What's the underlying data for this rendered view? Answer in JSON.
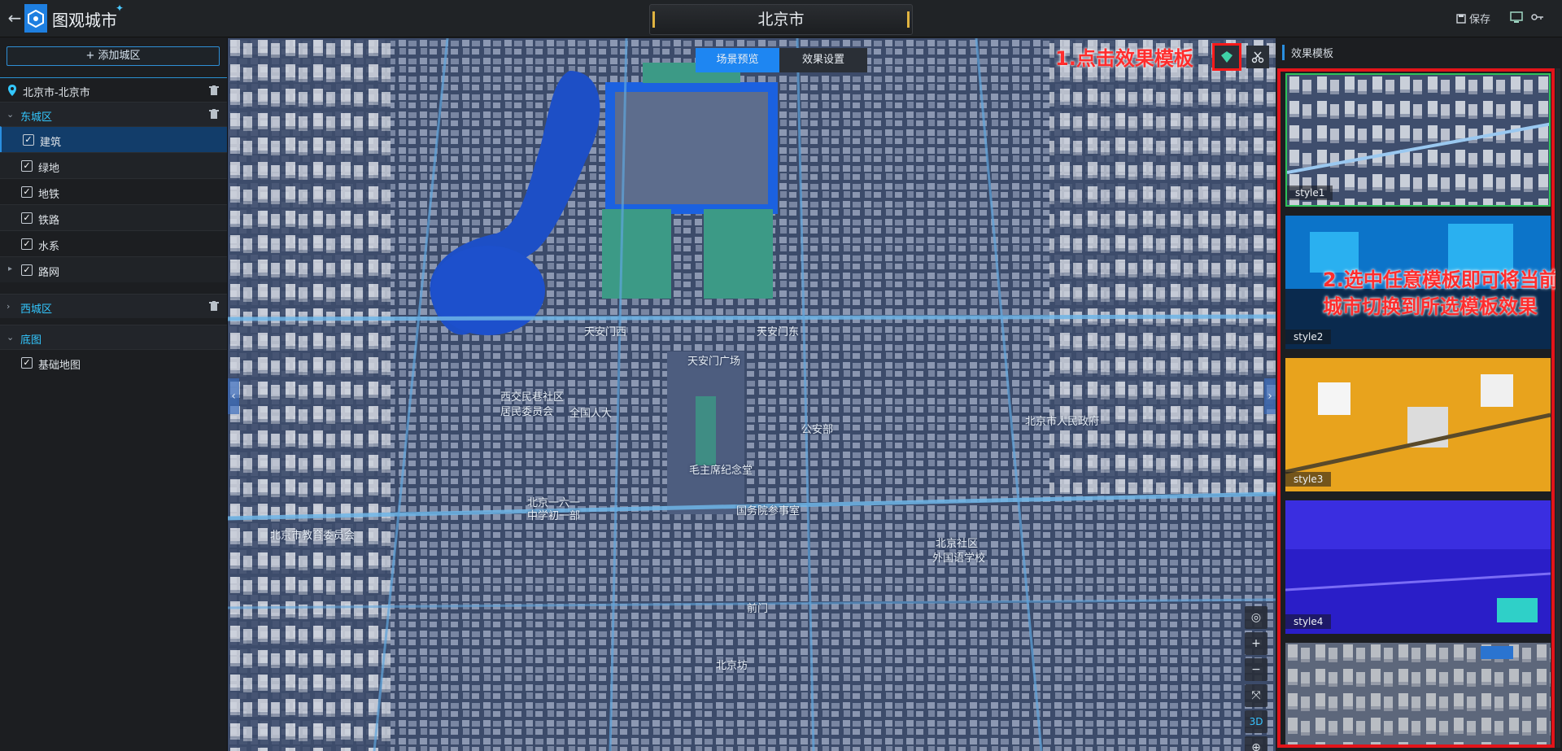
{
  "header": {
    "app_title": "图观城市",
    "city_title": "北京市",
    "save_label": "保存"
  },
  "sidebar": {
    "add_district_label": "+ 添加城区",
    "city_label": "北京市-北京市",
    "groups": [
      {
        "label": "东城区",
        "expanded": true
      },
      {
        "label": "西城区",
        "expanded": false
      },
      {
        "label": "底图",
        "expanded": true
      }
    ],
    "dongcheng_items": [
      {
        "label": "建筑",
        "checked": true
      },
      {
        "label": "绿地",
        "checked": true
      },
      {
        "label": "地铁",
        "checked": true
      },
      {
        "label": "铁路",
        "checked": true
      },
      {
        "label": "水系",
        "checked": true
      },
      {
        "label": "路网",
        "checked": true
      }
    ],
    "basemap_items": [
      {
        "label": "基础地图",
        "checked": true
      }
    ]
  },
  "map": {
    "tab_preview": "场景预览",
    "tab_settings": "效果设置",
    "annotation_1": "1.点击效果模板",
    "control_3d": "3D",
    "labels": [
      "天安门西",
      "天安门东",
      "天安门广场",
      "全国人大",
      "西交民巷社区",
      "居民委员会",
      "北京一六一",
      "中学初一部",
      "国务院参事室",
      "毛主席纪念堂",
      "前门",
      "北京社区",
      "外国语学校",
      "北京市教育委员会",
      "北京坊",
      "公安部",
      "北京市人民政府"
    ]
  },
  "right_panel": {
    "title": "效果模板",
    "annotation_2": "2.选中任意模板即可将当前城市切换到所选模板效果",
    "templates": [
      {
        "label": "style1"
      },
      {
        "label": "style2"
      },
      {
        "label": "style3"
      },
      {
        "label": "style4"
      },
      {
        "label": ""
      }
    ]
  },
  "colors": {
    "accent": "#1e86f2",
    "active_text": "#33c7ff",
    "annotation": "#ff2d2d",
    "selected_border": "#2fc25b"
  }
}
